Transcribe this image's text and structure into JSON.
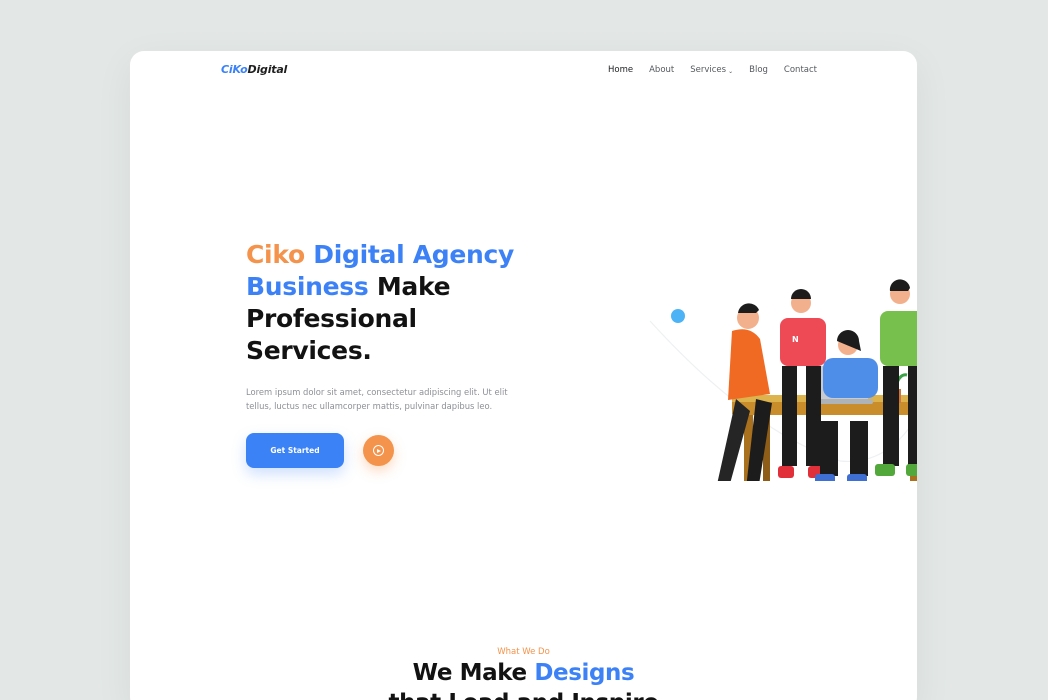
{
  "logo": {
    "part1": "CiKo",
    "part2": "Digital"
  },
  "nav": {
    "items": [
      {
        "label": "Home"
      },
      {
        "label": "About"
      },
      {
        "label": "Services"
      },
      {
        "label": "Blog"
      },
      {
        "label": "Contact"
      }
    ]
  },
  "hero": {
    "title_ciko": "Ciko",
    "title_blue_1": "Digital Agency",
    "title_blue_2": "Business",
    "title_rest_1": "Make",
    "title_rest_2": "Professional",
    "title_rest_3": "Services.",
    "description": "Lorem ipsum dolor sit amet, consectetur adipiscing elit. Ut elit tellus, luctus nec ullamcorper mattis, pulvinar dapibus leo.",
    "cta_label": "Get Started"
  },
  "section": {
    "eyebrow": "What We Do",
    "title_part1": "We Make",
    "title_part2": "Designs",
    "title_line2": "that Lead and Inspire"
  },
  "colors": {
    "accent_blue": "#3b82f6",
    "accent_orange": "#f4934b",
    "background": "#e3e8e6"
  }
}
